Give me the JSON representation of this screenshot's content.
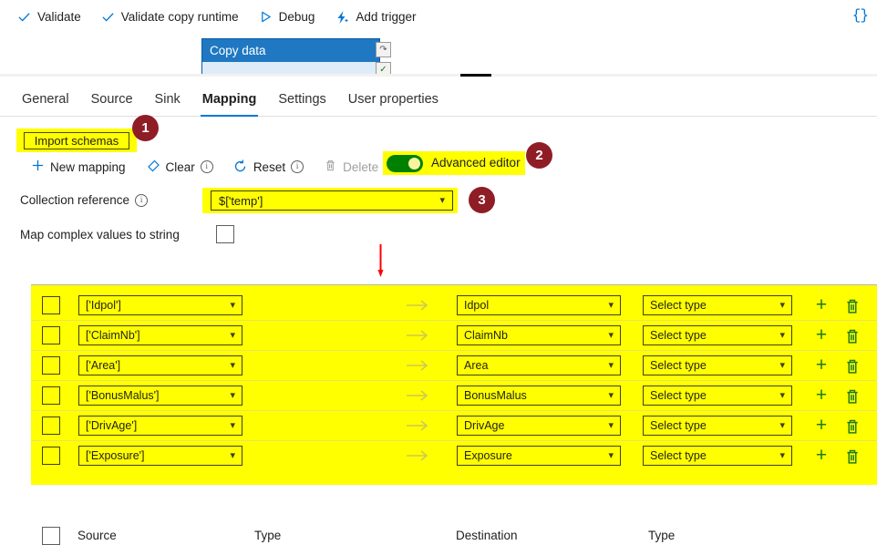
{
  "toolbar": {
    "items": [
      {
        "label": "Validate",
        "icon": "checkmark-icon"
      },
      {
        "label": "Validate copy runtime",
        "icon": "checkmark-icon"
      },
      {
        "label": "Debug",
        "icon": "play-triangle-icon"
      },
      {
        "label": "Add trigger",
        "icon": "lightning-bolt-icon"
      }
    ],
    "code_icon": "{}"
  },
  "canvas": {
    "activity_title": "Copy data"
  },
  "tabs": [
    {
      "label": "General",
      "active": false
    },
    {
      "label": "Source",
      "active": false
    },
    {
      "label": "Sink",
      "active": false
    },
    {
      "label": "Mapping",
      "active": true
    },
    {
      "label": "Settings",
      "active": false
    },
    {
      "label": "User properties",
      "active": false
    }
  ],
  "mapping": {
    "import_schemas_label": "Import schemas",
    "new_mapping_label": "New mapping",
    "clear_label": "Clear",
    "reset_label": "Reset",
    "delete_label": "Delete",
    "advanced_editor_label": "Advanced editor",
    "advanced_editor_on": true,
    "collection_reference_label": "Collection reference",
    "collection_reference_value": "$['temp']",
    "map_complex_label": "Map complex values to string",
    "map_complex_checked": false
  },
  "table": {
    "headers": {
      "source": "Source",
      "type1": "Type",
      "destination": "Destination",
      "type2": "Type"
    },
    "type_placeholder": "Select type",
    "rows": [
      {
        "source": "['Idpol']",
        "destination": "Idpol",
        "type": "Select type"
      },
      {
        "source": "['ClaimNb']",
        "destination": "ClaimNb",
        "type": "Select type"
      },
      {
        "source": "['Area']",
        "destination": "Area",
        "type": "Select type"
      },
      {
        "source": "['BonusMalus']",
        "destination": "BonusMalus",
        "type": "Select type"
      },
      {
        "source": "['DrivAge']",
        "destination": "DrivAge",
        "type": "Select type"
      },
      {
        "source": "['Exposure']",
        "destination": "Exposure",
        "type": "Select type"
      }
    ]
  },
  "annotations": {
    "badge1": "1",
    "badge2": "2",
    "badge3": "3",
    "highlight_color": "#ffff00",
    "badge_color": "#8f1d26",
    "arrow_color": "#ff0000",
    "accent_color": "#0078d4",
    "toggle_on_color": "#008000"
  }
}
